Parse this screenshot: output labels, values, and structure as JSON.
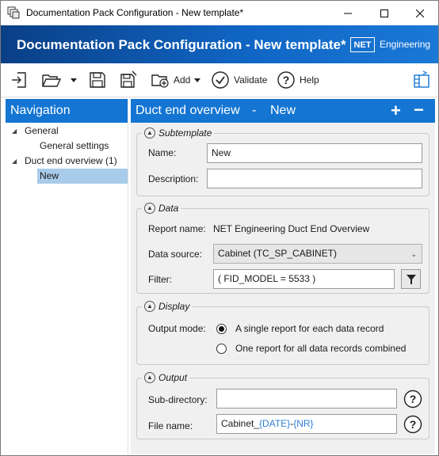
{
  "window": {
    "title": "Documentation Pack Configuration - New template*"
  },
  "banner": {
    "title": "Documentation Pack Configuration - New template*",
    "logo_mark": "NET",
    "logo_text": "Engineering"
  },
  "toolbar": {
    "add_label": "Add",
    "validate_label": "Validate",
    "help_label": "Help"
  },
  "navigation": {
    "title": "Navigation",
    "items": [
      {
        "label": "General"
      },
      {
        "label": "General settings"
      },
      {
        "label": "Duct end overview (1)"
      },
      {
        "label": "New"
      }
    ]
  },
  "main": {
    "title": "Duct end overview",
    "separator": "-",
    "subtitle": "New",
    "add_symbol": "+",
    "remove_symbol": "−"
  },
  "subtemplate": {
    "title": "Subtemplate",
    "name_label": "Name:",
    "name_value": "New",
    "description_label": "Description:",
    "description_value": ""
  },
  "data": {
    "title": "Data",
    "report_name_label": "Report name:",
    "report_name_value": "NET Engineering Duct End Overview",
    "data_source_label": "Data source:",
    "data_source_value": "Cabinet (TC_SP_CABINET)",
    "filter_label": "Filter:",
    "filter_value": "( FID_MODEL = 5533 )"
  },
  "display": {
    "title": "Display",
    "output_mode_label": "Output mode:",
    "option_single": "A single report for each data record",
    "option_combined": "One report for all data records combined",
    "selected": "single"
  },
  "output": {
    "title": "Output",
    "subdir_label": "Sub-directory:",
    "subdir_value": "",
    "filename_label": "File name:",
    "filename_prefix": "Cabinet_",
    "filename_date": "{DATE}",
    "filename_dash": "-",
    "filename_nr": "{NR}"
  },
  "colors": {
    "accent": "#1475d3",
    "banner_dark": "#0a3f86",
    "selection": "#a9cbea",
    "placeholder": "#2e7fd6"
  }
}
